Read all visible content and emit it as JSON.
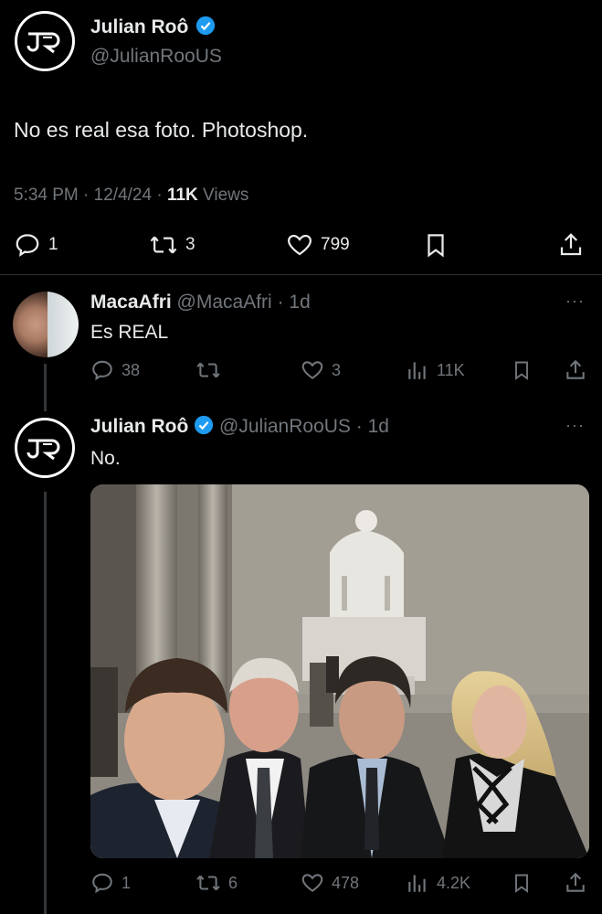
{
  "main_tweet": {
    "author_name": "Julian Roô",
    "author_handle": "@JulianRooUS",
    "text": "No es real esa foto. Photoshop.",
    "time": "5:34 PM",
    "date": "12/4/24",
    "views_count": "11K",
    "views_label": "Views",
    "replies": "1",
    "reposts": "3",
    "likes": "799"
  },
  "reply1": {
    "author_name": "MacaAfri",
    "author_handle": "@MacaAfri",
    "age": "1d",
    "text": "Es REAL",
    "replies": "38",
    "likes": "3",
    "views": "11K"
  },
  "reply2": {
    "author_name": "Julian Roô",
    "author_handle": "@JulianRooUS",
    "age": "1d",
    "text": "No.",
    "replies": "1",
    "reposts": "6",
    "likes": "478",
    "views": "4.2K"
  },
  "colors": {
    "background": "#000000",
    "text": "#e7e9ea",
    "muted": "#71767b",
    "verified": "#1d9bf0",
    "divider": "#2f3336"
  }
}
